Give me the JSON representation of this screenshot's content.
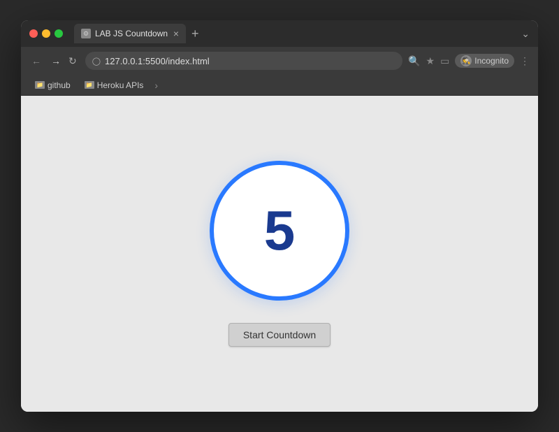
{
  "browser": {
    "tab_title": "LAB JS Countdown",
    "tab_favicon": "JS",
    "url": "127.0.0.1:5500/index.html",
    "incognito_label": "Incognito",
    "tab_close": "×",
    "new_tab": "+",
    "window_menu": "⌄"
  },
  "bookmarks": [
    {
      "label": "github",
      "icon": "📁"
    },
    {
      "label": "Heroku APIs",
      "icon": "📁"
    }
  ],
  "page": {
    "countdown_value": "5",
    "start_button_label": "Start Countdown"
  },
  "colors": {
    "circle_border": "#2979ff",
    "countdown_text": "#1a3a8f",
    "button_bg": "#d0d0d0"
  }
}
